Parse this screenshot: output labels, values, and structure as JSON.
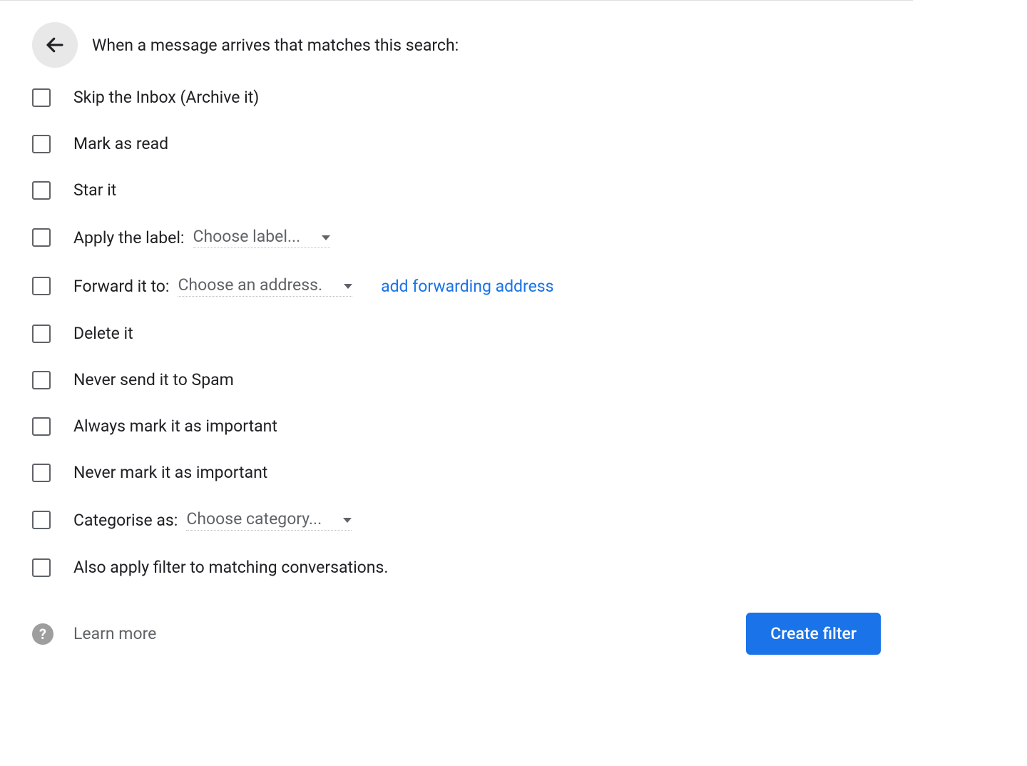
{
  "header": {
    "title": "When a message arrives that matches this search:"
  },
  "options": {
    "skip_inbox": "Skip the Inbox (Archive it)",
    "mark_read": "Mark as read",
    "star_it": "Star it",
    "apply_label": "Apply the label:",
    "apply_label_dropdown": "Choose label...",
    "forward_to": "Forward it to:",
    "forward_to_dropdown": "Choose an address.",
    "forward_link": "add forwarding address",
    "delete_it": "Delete it",
    "never_spam": "Never send it to Spam",
    "always_important": "Always mark it as important",
    "never_important": "Never mark it as important",
    "categorise_as": "Categorise as:",
    "categorise_dropdown": "Choose category...",
    "also_apply": "Also apply filter to matching conversations."
  },
  "footer": {
    "help_glyph": "?",
    "learn_more": "Learn more",
    "create_button": "Create filter"
  }
}
